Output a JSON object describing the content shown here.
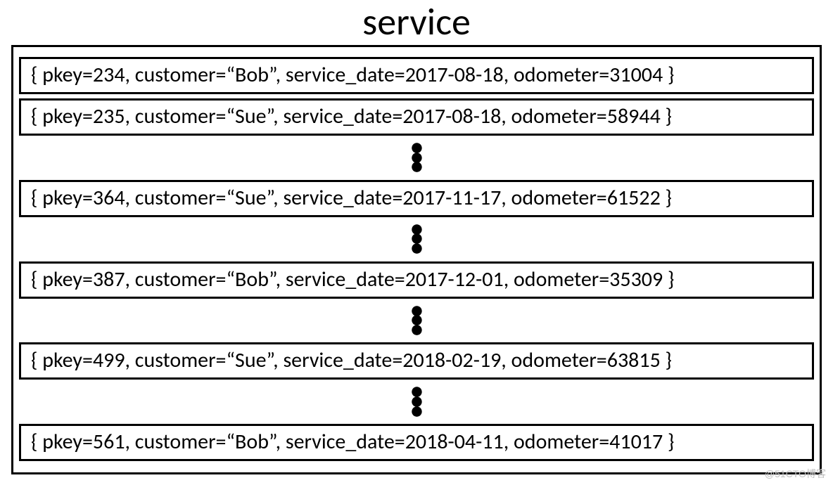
{
  "title": "service",
  "records": [
    {
      "pkey": 234,
      "customer": "Bob",
      "service_date": "2017-08-18",
      "odometer": 31004
    },
    {
      "pkey": 235,
      "customer": "Sue",
      "service_date": "2017-08-18",
      "odometer": 58944
    },
    {
      "pkey": 364,
      "customer": "Sue",
      "service_date": "2017-11-17",
      "odometer": 61522
    },
    {
      "pkey": 387,
      "customer": "Bob",
      "service_date": "2017-12-01",
      "odometer": 35309
    },
    {
      "pkey": 499,
      "customer": "Sue",
      "service_date": "2018-02-19",
      "odometer": 63815
    },
    {
      "pkey": 561,
      "customer": "Bob",
      "service_date": "2018-04-11",
      "odometer": 41017
    }
  ],
  "rows": [
    "{ pkey=234, customer=“Bob”, service_date=2017-08-18, odometer=31004 }",
    "{ pkey=235, customer=“Sue”, service_date=2017-08-18, odometer=58944 }",
    "{ pkey=364, customer=“Sue”, service_date=2017-11-17, odometer=61522 }",
    "{ pkey=387, customer=“Bob”, service_date=2017-12-01, odometer=35309 }",
    "{ pkey=499, customer=“Sue”, service_date=2018-02-19, odometer=63815 }",
    "{ pkey=561, customer=“Bob”, service_date=2018-04-11, odometer=41017 }"
  ],
  "watermark": "@51CTO博客"
}
